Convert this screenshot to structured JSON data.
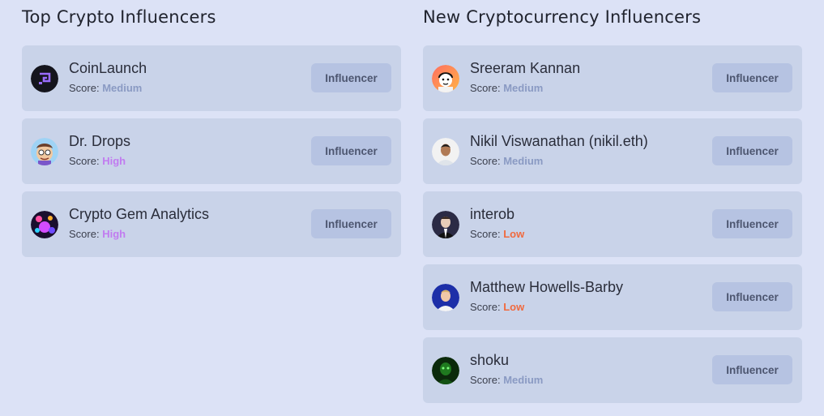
{
  "sections": [
    {
      "title": "Top Crypto Influencers",
      "score_label": "Score:",
      "items": [
        {
          "name": "CoinLaunch",
          "score": "Medium",
          "level": "medium",
          "badge": "Influencer",
          "avatar": "coinlaunch-logo-icon"
        },
        {
          "name": "Dr. Drops",
          "score": "High",
          "level": "high",
          "badge": "Influencer",
          "avatar": "cartoon-avatar-icon"
        },
        {
          "name": "Crypto Gem Analytics",
          "score": "High",
          "level": "high",
          "badge": "Influencer",
          "avatar": "gem-avatar-icon"
        }
      ]
    },
    {
      "title": "New Cryptocurrency Influencers",
      "score_label": "Score:",
      "items": [
        {
          "name": "Sreeram Kannan",
          "score": "Medium",
          "level": "medium",
          "badge": "Influencer",
          "avatar": "cartoon-portrait-icon"
        },
        {
          "name": "Nikil Viswanathan (nikil.eth)",
          "score": "Medium",
          "level": "medium",
          "badge": "Influencer",
          "avatar": "person-photo-icon"
        },
        {
          "name": "interob",
          "score": "Low",
          "level": "low",
          "badge": "Influencer",
          "avatar": "person-photo-icon"
        },
        {
          "name": "Matthew Howells-Barby",
          "score": "Low",
          "level": "low",
          "badge": "Influencer",
          "avatar": "person-photo-icon"
        },
        {
          "name": "shoku",
          "score": "Medium",
          "level": "medium",
          "badge": "Influencer",
          "avatar": "green-portrait-icon"
        }
      ]
    }
  ],
  "colors": {
    "background": "#dce2f6",
    "card": "#c9d3e9",
    "badge": "#b6c3e2",
    "score_medium": "#8a9ac3",
    "score_high": "#c17bf0",
    "score_low": "#f06a3f"
  }
}
